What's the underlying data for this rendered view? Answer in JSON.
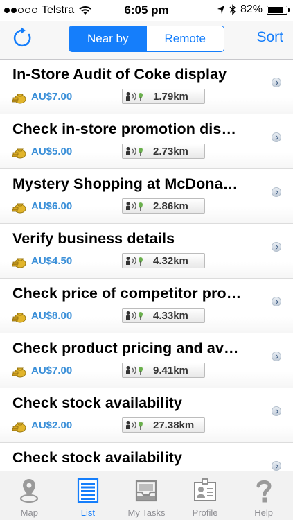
{
  "status_bar": {
    "carrier": "Telstra",
    "time": "6:05 pm",
    "battery": "82%",
    "battery_level": 0.82,
    "signal_bars": 2
  },
  "nav": {
    "segments": [
      "Near by",
      "Remote"
    ],
    "selected_segment": "Near by",
    "sort_label": "Sort"
  },
  "tasks": [
    {
      "title": "In-Store Audit of Coke display",
      "price": "AU$7.00",
      "distance": "1.79km"
    },
    {
      "title": "Check in-store promotion dis…",
      "price": "AU$5.00",
      "distance": "2.73km"
    },
    {
      "title": "Mystery Shopping at McDona…",
      "price": "AU$6.00",
      "distance": "2.86km"
    },
    {
      "title": "Verify business details",
      "price": "AU$4.50",
      "distance": "4.32km"
    },
    {
      "title": "Check price of competitor pro…",
      "price": "AU$8.00",
      "distance": "4.33km"
    },
    {
      "title": "Check product pricing and av…",
      "price": "AU$7.00",
      "distance": "9.41km"
    },
    {
      "title": "Check stock availability",
      "price": "AU$2.00",
      "distance": "27.38km"
    },
    {
      "title": "Check stock availability",
      "price": "",
      "distance": ""
    }
  ],
  "tab_bar": {
    "tabs": [
      {
        "label": "Map",
        "icon": "map-pin-icon"
      },
      {
        "label": "List",
        "icon": "list-icon"
      },
      {
        "label": "My Tasks",
        "icon": "inbox-tray-icon"
      },
      {
        "label": "Profile",
        "icon": "id-badge-icon"
      },
      {
        "label": "Help",
        "icon": "question-mark-icon"
      }
    ],
    "selected": "List"
  },
  "colors": {
    "accent": "#157efb",
    "price": "#3a8fd8",
    "tab_inactive": "#8e8e93"
  }
}
